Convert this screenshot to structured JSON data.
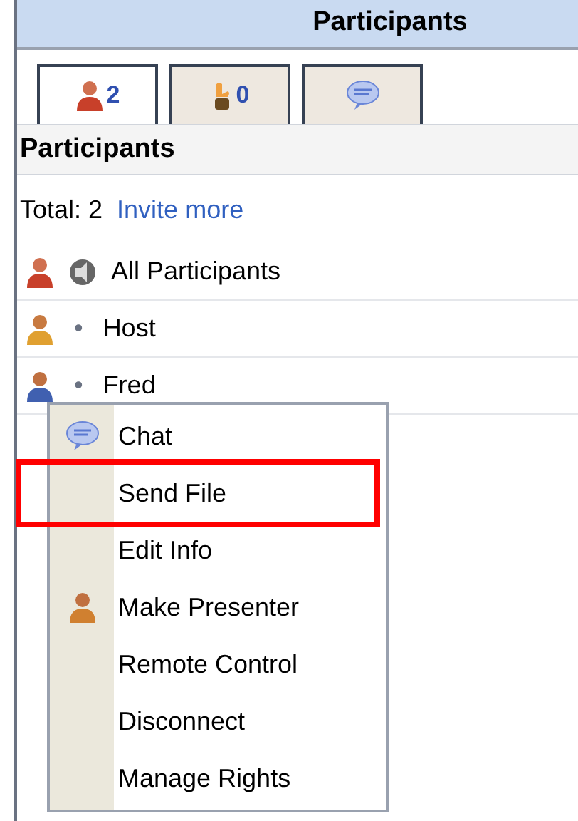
{
  "panel": {
    "title": "Participants"
  },
  "tabs": [
    {
      "kind": "people",
      "count": "2",
      "selected": true
    },
    {
      "kind": "raised",
      "count": "0",
      "selected": false
    },
    {
      "kind": "chat",
      "selected": false
    }
  ],
  "section_title": "Participants",
  "summary": {
    "total": "Total: 2",
    "link": "Invite more"
  },
  "participants": [
    {
      "kind": "group",
      "name": "All Participants"
    },
    {
      "kind": "host",
      "bullet": "•",
      "name": "Host"
    },
    {
      "kind": "attendee",
      "bullet": "•",
      "name": "Fred"
    }
  ],
  "context_menu": {
    "items": [
      {
        "label": "Chat",
        "kind": "chat",
        "highlighted": false
      },
      {
        "label": "Send File",
        "highlighted": true
      },
      {
        "label": "Edit Info",
        "highlighted": false
      },
      {
        "label": "Make Presenter",
        "kind": "presenter",
        "highlighted": false
      },
      {
        "label": "Remote Control",
        "highlighted": false
      },
      {
        "label": "Disconnect",
        "highlighted": false
      },
      {
        "label": "Manage Rights",
        "highlighted": false
      }
    ]
  }
}
